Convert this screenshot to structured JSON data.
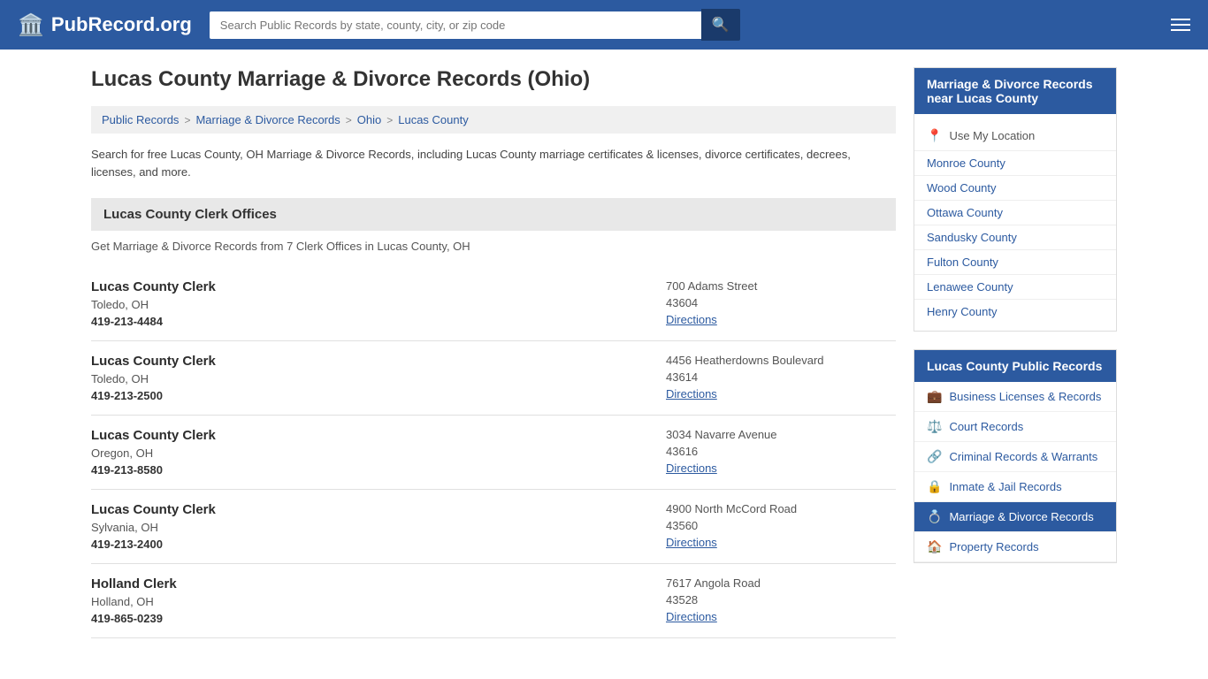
{
  "header": {
    "logo_text": "PubRecord.org",
    "search_placeholder": "Search Public Records by state, county, city, or zip code"
  },
  "page": {
    "title": "Lucas County Marriage & Divorce Records (Ohio)",
    "breadcrumb": [
      {
        "label": "Public Records",
        "href": "#"
      },
      {
        "label": "Marriage & Divorce Records",
        "href": "#"
      },
      {
        "label": "Ohio",
        "href": "#"
      },
      {
        "label": "Lucas County",
        "href": "#"
      }
    ],
    "intro": "Search for free Lucas County, OH Marriage & Divorce Records, including Lucas County marriage certificates & licenses, divorce certificates, decrees, licenses, and more.",
    "section_title": "Lucas County Clerk Offices",
    "section_desc": "Get Marriage & Divorce Records from 7 Clerk Offices in Lucas County, OH",
    "clerks": [
      {
        "name": "Lucas County Clerk",
        "city": "Toledo, OH",
        "phone": "419-213-4484",
        "address": "700 Adams Street",
        "zip": "43604",
        "directions": "Directions"
      },
      {
        "name": "Lucas County Clerk",
        "city": "Toledo, OH",
        "phone": "419-213-2500",
        "address": "4456 Heatherdowns Boulevard",
        "zip": "43614",
        "directions": "Directions"
      },
      {
        "name": "Lucas County Clerk",
        "city": "Oregon, OH",
        "phone": "419-213-8580",
        "address": "3034 Navarre Avenue",
        "zip": "43616",
        "directions": "Directions"
      },
      {
        "name": "Lucas County Clerk",
        "city": "Sylvania, OH",
        "phone": "419-213-2400",
        "address": "4900 North McCord Road",
        "zip": "43560",
        "directions": "Directions"
      },
      {
        "name": "Holland Clerk",
        "city": "Holland, OH",
        "phone": "419-865-0239",
        "address": "7617 Angola Road",
        "zip": "43528",
        "directions": "Directions"
      }
    ]
  },
  "sidebar": {
    "nearby_title": "Marriage & Divorce Records near Lucas County",
    "use_location": "Use My Location",
    "nearby_counties": [
      "Monroe County",
      "Wood County",
      "Ottawa County",
      "Sandusky County",
      "Fulton County",
      "Lenawee County",
      "Henry County"
    ],
    "public_records_title": "Lucas County Public Records",
    "public_records": [
      {
        "label": "Business Licenses & Records",
        "icon": "💼",
        "active": false
      },
      {
        "label": "Court Records",
        "icon": "⚖️",
        "active": false
      },
      {
        "label": "Criminal Records & Warrants",
        "icon": "🔗",
        "active": false
      },
      {
        "label": "Inmate & Jail Records",
        "icon": "🔒",
        "active": false
      },
      {
        "label": "Marriage & Divorce Records",
        "icon": "💍",
        "active": true
      },
      {
        "label": "Property Records",
        "icon": "🏠",
        "active": false
      }
    ]
  }
}
